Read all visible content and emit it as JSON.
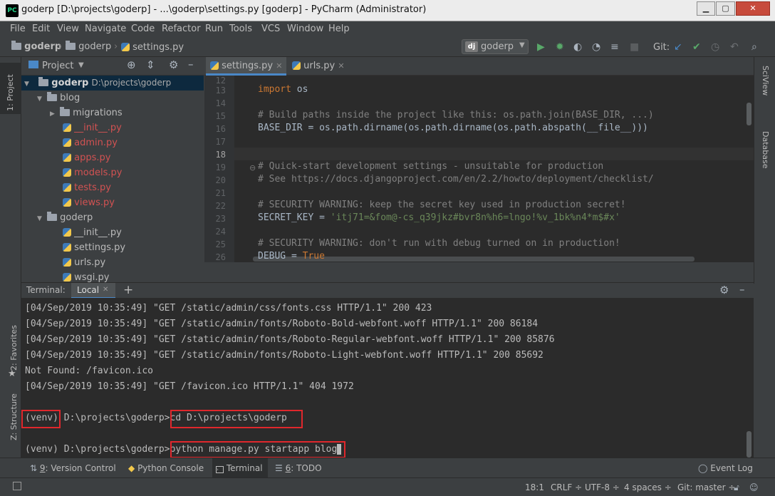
{
  "window": {
    "app_icon": "PC",
    "title": "goderp [D:\\projects\\goderp] - ...\\goderp\\settings.py [goderp] - PyCharm (Administrator)",
    "minimize": "▁",
    "maximize": "▢",
    "close": "✕"
  },
  "menu": [
    "File",
    "Edit",
    "View",
    "Navigate",
    "Code",
    "Refactor",
    "Run",
    "Tools",
    "VCS",
    "Window",
    "Help"
  ],
  "breadcrumb": [
    "goderp",
    "goderp",
    "settings.py"
  ],
  "run_config": "goderp",
  "git_label": "Git:",
  "project_panel": {
    "title": "Project",
    "tree": [
      {
        "label": "goderp",
        "extra": "D:\\projects\\goderp"
      },
      {
        "label": "blog"
      },
      {
        "label": "migrations"
      },
      {
        "label": "__init__.py"
      },
      {
        "label": "admin.py"
      },
      {
        "label": "apps.py"
      },
      {
        "label": "models.py"
      },
      {
        "label": "tests.py"
      },
      {
        "label": "views.py"
      },
      {
        "label": "goderp"
      },
      {
        "label": "__init__.py"
      },
      {
        "label": "settings.py"
      },
      {
        "label": "urls.py"
      },
      {
        "label": "wsgi.py"
      }
    ]
  },
  "side_tabs": {
    "project": "1: Project",
    "favorites": "2: Favorites",
    "structure": "Z: Structure",
    "sciview": "SciView",
    "database": "Database"
  },
  "editor": {
    "tabs": [
      "settings.py",
      "urls.py"
    ],
    "line_numbers": [
      "12",
      "13",
      "14",
      "15",
      "16",
      "17",
      "18",
      "19",
      "20",
      "21",
      "22",
      "23",
      "24",
      "25",
      "26"
    ],
    "lines": {
      "l13_kw": "import",
      "l13_rest": " os",
      "l15": "# Build paths inside the project like this: os.path.join(BASE_DIR, ...)",
      "l16": "BASE_DIR = os.path.dirname(os.path.dirname(os.path.abspath(__file__)))",
      "l19": "# Quick-start development settings - unsuitable for production",
      "l20": "# See https://docs.djangoproject.com/en/2.2/howto/deployment/checklist/",
      "l22": "# SECURITY WARNING: keep the secret key used in production secret!",
      "l23_a": "SECRET_KEY = ",
      "l23_b": "'itj71=&fom@-cs_q39jkz#bvr8n%h6=lngo!%v_1bk%n4*m$#x'",
      "l25": "# SECURITY WARNING: don't run with debug turned on in production!",
      "l26_a": "DEBUG = ",
      "l26_b": "True"
    }
  },
  "terminal": {
    "title": "Terminal:",
    "tab": "Local",
    "add": "+",
    "lines": [
      "[04/Sep/2019 10:35:49] \"GET /static/admin/css/fonts.css HTTP/1.1\" 200 423",
      "[04/Sep/2019 10:35:49] \"GET /static/admin/fonts/Roboto-Bold-webfont.woff HTTP/1.1\" 200 86184",
      "[04/Sep/2019 10:35:49] \"GET /static/admin/fonts/Roboto-Regular-webfont.woff HTTP/1.1\" 200 85876",
      "[04/Sep/2019 10:35:49] \"GET /static/admin/fonts/Roboto-Light-webfont.woff HTTP/1.1\" 200 85692",
      "Not Found: /favicon.ico",
      "[04/Sep/2019 10:35:49] \"GET /favicon.ico HTTP/1.1\" 404 1972"
    ],
    "prompt1_venv": "(venv)",
    "prompt1_path": " D:\\projects\\goderp>",
    "prompt1_cmd": "cd D:\\projects\\goderp",
    "prompt2_prefix": "(venv) D:\\projects\\goderp>",
    "prompt2_cmd": "python manage.py startapp blog"
  },
  "tool_windows": [
    {
      "key": "9",
      "label": ": Version Control"
    },
    {
      "key": "",
      "label": "Python Console"
    },
    {
      "key": "",
      "label": "Terminal"
    },
    {
      "key": "6",
      "label": ": TODO"
    }
  ],
  "event_log": "Event Log",
  "status": {
    "position": "18:1",
    "line_sep": "CRLF ÷",
    "encoding": "UTF-8 ÷",
    "indent": "4 spaces ÷",
    "git": "Git: master ÷"
  },
  "colors": {
    "accent": "#4a88c7",
    "highlight_box": "#e0272c",
    "run_green": "#59a869"
  }
}
